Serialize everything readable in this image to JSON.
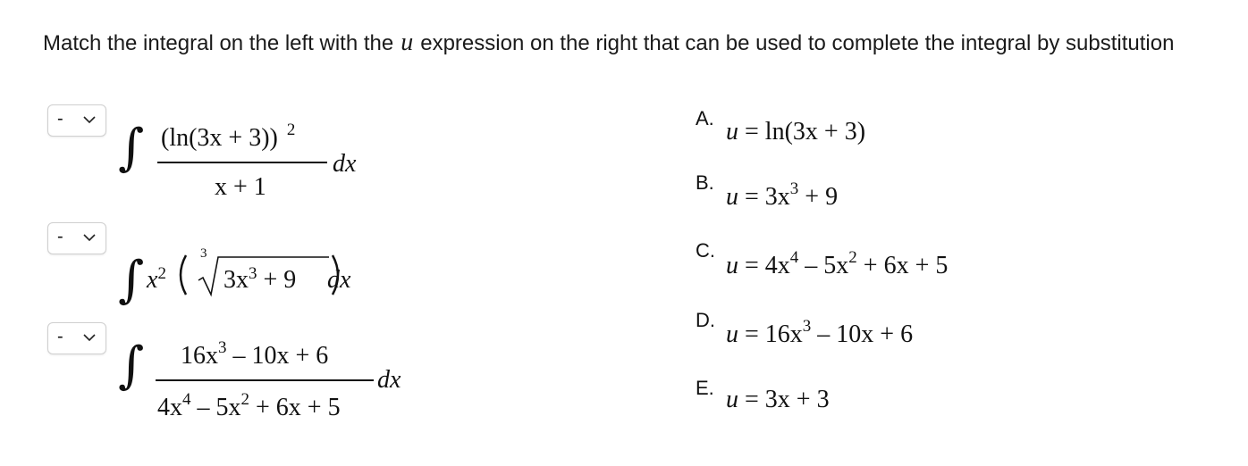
{
  "prompt": {
    "before": "Match the integral on the left with the",
    "variable": "u",
    "after": "expression on the right that can be used to complete the integral by substitution"
  },
  "questions": [
    {
      "select_value": "-",
      "numerator": "(ln(3x + 3))",
      "numerator_exp": "2",
      "denominator": "x + 1",
      "differential": "dx"
    },
    {
      "select_value": "-",
      "factor": "x",
      "factor_exp": "2",
      "root_index": "3",
      "radicand": "3x",
      "radicand_exp": "3",
      "radicand_tail": "+ 9",
      "differential": "dx"
    },
    {
      "select_value": "-",
      "numerator": "16x",
      "numerator_exp": "3",
      "numerator_tail": "– 10x + 6",
      "denominator": "4x",
      "denominator_exp1": "4",
      "denominator_mid": "– 5x",
      "denominator_exp2": "2",
      "denominator_tail": "+ 6x + 5",
      "differential": "dx"
    }
  ],
  "options": [
    {
      "letter": "A.",
      "lhs": "u",
      "eq": "=",
      "rhs": "ln(3x + 3)"
    },
    {
      "letter": "B.",
      "lhs": "u",
      "eq": "=",
      "rhs": "3x",
      "exp": "3",
      "tail": "+ 9"
    },
    {
      "letter": "C.",
      "lhs": "u",
      "eq": "=",
      "rhs": "4x",
      "exp": "4",
      "mid": "– 5x",
      "exp2": "2",
      "tail": "+ 6x + 5"
    },
    {
      "letter": "D.",
      "lhs": "u",
      "eq": "=",
      "rhs": "16x",
      "exp": "3",
      "tail": "– 10x + 6"
    },
    {
      "letter": "E.",
      "lhs": "u",
      "eq": "=",
      "rhs": "3x + 3"
    }
  ]
}
